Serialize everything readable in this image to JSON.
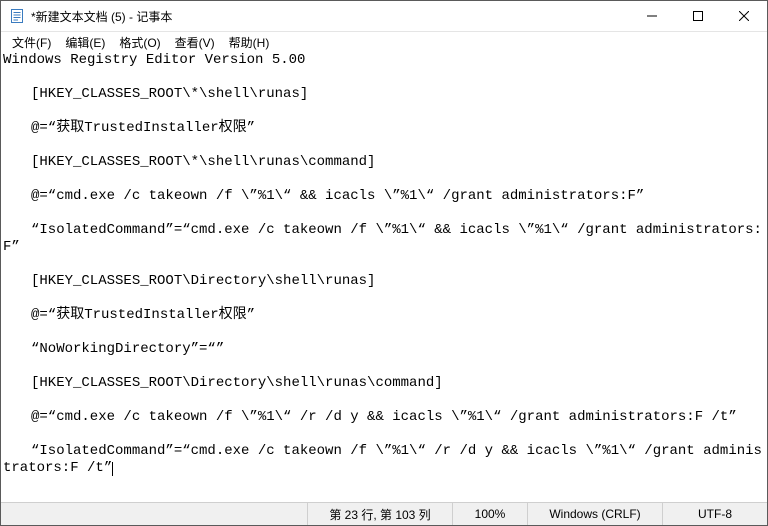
{
  "title": "*新建文本文档 (5) - 记事本",
  "menu": {
    "file": "文件(F)",
    "edit": "编辑(E)",
    "format": "格式(O)",
    "view": "查看(V)",
    "help": "帮助(H)"
  },
  "content": "Windows Registry Editor Version 5.00\n\n　　[HKEY_CLASSES_ROOT\\*\\shell\\runas]\n\n　　@=“获取TrustedInstaller权限”\n\n　　[HKEY_CLASSES_ROOT\\*\\shell\\runas\\command]\n\n　　@=“cmd.exe /c takeown /f \\”%1\\“ && icacls \\”%1\\“ /grant administrators:F”\n\n　　“IsolatedCommand”=“cmd.exe /c takeown /f \\”%1\\“ && icacls \\”%1\\“ /grant administrators:F”\n\n　　[HKEY_CLASSES_ROOT\\Directory\\shell\\runas]\n\n　　@=“获取TrustedInstaller权限”\n\n　　“NoWorkingDirectory”=“”\n\n　　[HKEY_CLASSES_ROOT\\Directory\\shell\\runas\\command]\n\n　　@=“cmd.exe /c takeown /f \\”%1\\“ /r /d y && icacls \\”%1\\“ /grant administrators:F /t”\n\n　　“IsolatedCommand”=“cmd.exe /c takeown /f \\”%1\\“ /r /d y && icacls \\”%1\\“ /grant administrators:F /t”",
  "status": {
    "position": "第 23 行, 第 103 列",
    "zoom": "100%",
    "lineending": "Windows (CRLF)",
    "encoding": "UTF-8"
  }
}
